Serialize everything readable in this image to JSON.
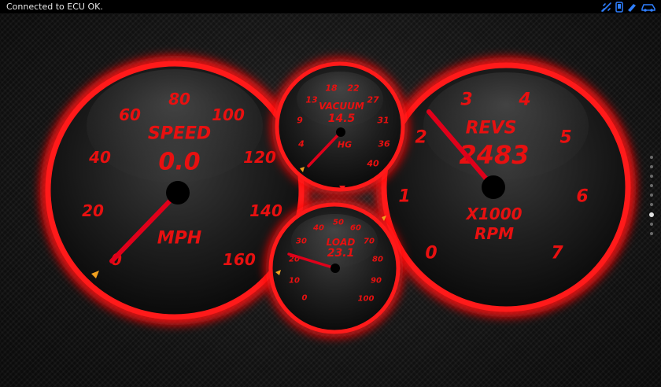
{
  "statusbar": {
    "text": "Connected to ECU OK.",
    "icons": [
      "satellite-icon",
      "phone-icon",
      "bluetooth-icon",
      "car-icon"
    ],
    "icon_color": "#2f7fff"
  },
  "theme": {
    "accent": "#ff1010",
    "label_color": "#e81010",
    "needle": "#e0001a",
    "peg": "#f0a020"
  },
  "gauges": {
    "speed": {
      "title": "SPEED",
      "value": "0.0",
      "unit": "MPH",
      "ticks": [
        "0",
        "20",
        "40",
        "60",
        "80",
        "100",
        "120",
        "140",
        "160"
      ],
      "min": 0,
      "max": 160,
      "needle_value": 0
    },
    "vacuum": {
      "title": "VACUUM",
      "value": "14.5",
      "unit": "HG",
      "ticks": [
        "4",
        "9",
        "13",
        "18",
        "22",
        "27",
        "31",
        "36",
        "40"
      ],
      "min": 0,
      "max": 40,
      "needle_value": 0
    },
    "revs": {
      "title": "REVS",
      "value": "2483",
      "unit": "X1000",
      "unit2": "RPM",
      "ticks": [
        "0",
        "1",
        "2",
        "3",
        "4",
        "5",
        "6",
        "7"
      ],
      "min": 0,
      "max": 7,
      "needle_value": 2.4
    },
    "load": {
      "title": "LOAD",
      "value": "23.1",
      "ticks": [
        "0",
        "10",
        "20",
        "30",
        "40",
        "50",
        "60",
        "70",
        "80",
        "90",
        "100"
      ],
      "min": 0,
      "max": 100,
      "needle_value": 23.1
    }
  },
  "pages": {
    "count": 9,
    "active": 6
  }
}
